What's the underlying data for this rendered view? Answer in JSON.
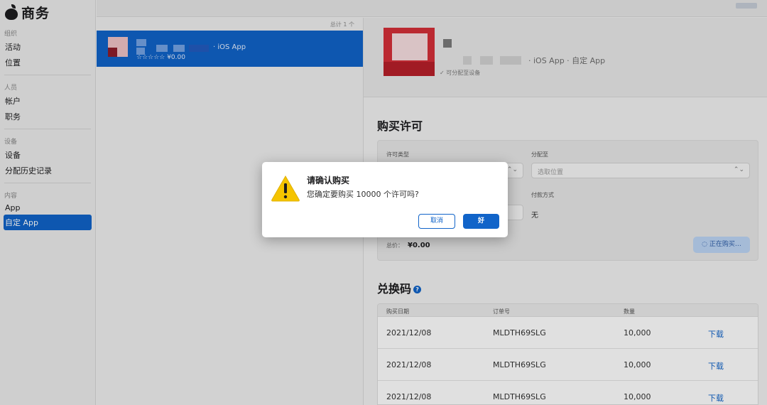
{
  "sidebar": {
    "brand": "商务",
    "sections": [
      {
        "title": "组织",
        "items": [
          {
            "label": "活动"
          },
          {
            "label": "位置"
          }
        ]
      },
      {
        "title": "人员",
        "items": [
          {
            "label": "帐户"
          },
          {
            "label": "职务"
          }
        ]
      },
      {
        "title": "设备",
        "items": [
          {
            "label": "设备"
          },
          {
            "label": "分配历史记录"
          }
        ]
      },
      {
        "title": "内容",
        "items": [
          {
            "label": "App"
          },
          {
            "label": "自定 App"
          }
        ]
      }
    ]
  },
  "list": {
    "count_label": "总计 1 个",
    "row": {
      "subtitle": "· iOS App",
      "rating_price": "☆☆☆☆☆ ¥0.00"
    }
  },
  "detail": {
    "subtitle": "· iOS App · 自定 App",
    "assignable": "✓ 可分配至设备",
    "purchase": {
      "heading": "购买许可",
      "license_type_label": "许可类型",
      "assign_to_label": "分配至",
      "assign_to_placeholder": "选取位置",
      "payment_label": "付款方式",
      "payment_value": "无",
      "total_label": "总价：",
      "total_value": "¥0.00",
      "buying_button": "正在购买…"
    },
    "codes": {
      "heading": "兑换码",
      "columns": [
        "购买日期",
        "订单号",
        "数量"
      ],
      "rows": [
        {
          "date": "2021/12/08",
          "order": "MLDTH69SLG",
          "qty": "10,000",
          "action": "下载"
        },
        {
          "date": "2021/12/08",
          "order": "MLDTH69SLG",
          "qty": "10,000",
          "action": "下载"
        },
        {
          "date": "2021/12/08",
          "order": "MLDTH69SLG",
          "qty": "10,000",
          "action": "下载"
        }
      ]
    }
  },
  "dialog": {
    "title": "请确认购买",
    "message": "您确定要购买 10000 个许可吗?",
    "cancel": "取消",
    "ok": "好"
  },
  "colors": {
    "accent": "#1164c9",
    "warning": "#f5c400"
  }
}
